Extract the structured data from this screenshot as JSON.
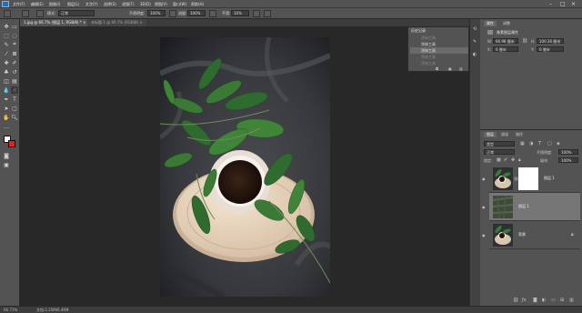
{
  "menubar": {
    "items": [
      "文件(F)",
      "编辑(E)",
      "图像(I)",
      "图层(L)",
      "文字(Y)",
      "选择(S)",
      "滤镜(T)",
      "3D(D)",
      "视图(V)",
      "窗口(W)",
      "帮助(H)"
    ]
  },
  "options": {
    "mode_label": "模式:",
    "mode_value": "正常",
    "opacity_label": "不透明度:",
    "opacity_value": "100%",
    "flow_label": "流量:",
    "flow_value": "100%",
    "smooth_label": "平滑:",
    "smooth_value": "10%"
  },
  "tabs": [
    {
      "label": "1.jpg @ 66.7% (图层 1, RGB/8) *",
      "close": "×"
    },
    {
      "label": "未标题-1 @ 66.7% (RGB/8) ×"
    }
  ],
  "history": {
    "title": "历史记录",
    "items": [
      "涂抹工具",
      "涂抹工具",
      "涂抹工具",
      "涂抹工具",
      "涂抹工具"
    ]
  },
  "properties": {
    "tab1": "属性",
    "tab2": "调整",
    "kind": "像素图层属性",
    "w_label": "W:",
    "w_value": "66.98 厘米",
    "h_label": "H:",
    "h_value": "100.36 厘米",
    "x_label": "X:",
    "x_value": "0 厘米",
    "y_label": "Y:",
    "y_value": "0 厘米"
  },
  "layers": {
    "tabs": [
      "图层",
      "通道",
      "路径"
    ],
    "search": "类型",
    "blend_mode": "正常",
    "opacity_label": "不透明度:",
    "opacity_value": "100%",
    "fill_label": "填充:",
    "fill_value": "100%",
    "lock_label": "锁定:",
    "rows": [
      {
        "name": "图层 1"
      },
      {
        "name": "图层 1"
      },
      {
        "name": "背景"
      }
    ]
  },
  "status": {
    "zoom": "66.71%",
    "doc_info": "文档:2.25M/6.46M"
  },
  "colors": {
    "foreground": "#ffffff",
    "background": "#e82020",
    "accent": "#2b6cb5"
  }
}
